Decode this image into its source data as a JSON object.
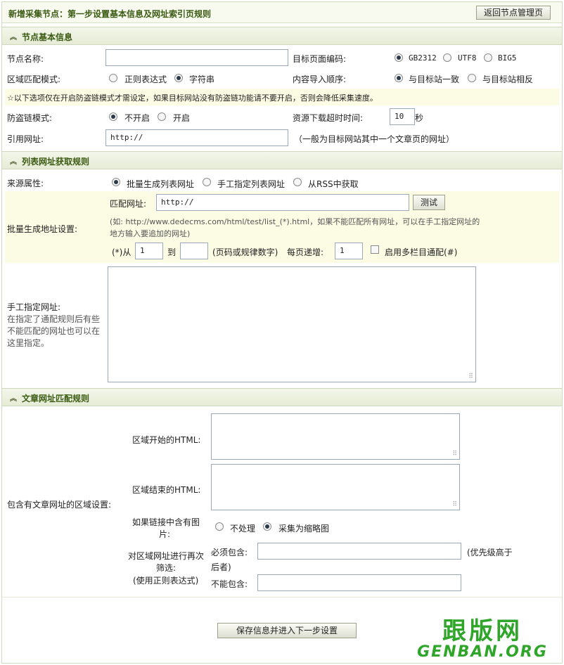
{
  "header": {
    "title": "新增采集节点：第一步设置基本信息及网址索引页规则",
    "back_button": "返回节点管理页"
  },
  "basic": {
    "section_title": "节点基本信息",
    "node_name_label": "节点名称:",
    "node_name_value": "",
    "encoding_label": "目标页面编码:",
    "encodings": [
      "GB2312",
      "UTF8",
      "BIG5"
    ],
    "encoding_selected": "GB2312",
    "match_mode_label": "区域匹配模式:",
    "match_modes": [
      "正则表达式",
      "字符串"
    ],
    "match_mode_selected": "字符串",
    "import_order_label": "内容导入顺序:",
    "import_orders": [
      "与目标站一致",
      "与目标站相反"
    ],
    "import_order_selected": "与目标站一致",
    "notice": "☆以下选项仅在开启防盗链模式才需设定，如果目标网站没有防盗链功能请不要开启，否则会降低采集速度。",
    "antileech_label": "防盗链模式:",
    "antileech_options": [
      "不开启",
      "开启"
    ],
    "antileech_selected": "不开启",
    "timeout_label": "资源下载超时时间:",
    "timeout_value": "10",
    "timeout_unit": "秒",
    "referer_label": "引用网址:",
    "referer_value": "http://",
    "referer_hint": "（一般为目标网站其中一个文章页的网址）"
  },
  "list_rules": {
    "section_title": "列表网址获取规则",
    "source_label": "来源属性:",
    "source_options": [
      "批量生成列表网址",
      "手工指定列表网址",
      "从RSS中获取"
    ],
    "source_selected": "批量生成列表网址",
    "batch_label": "批量生成地址设置:",
    "match_url_label": "匹配网址:",
    "match_url_value": "http://",
    "test_button": "测试",
    "example_line1": "(如: http://www.dedecms.com/html/test/list_(*).html，如果不能匹配所有网址，可以在手工指定网址的",
    "example_line2": "地方输入要追加的网址)",
    "from_label": "(*)从",
    "from_value": "1",
    "to_label": "到",
    "to_value": "",
    "to_hint": "(页码或规律数字)",
    "step_label": "每页递增:",
    "step_value": "1",
    "multi_label": "启用多栏目通配(#)",
    "manual_label": "手工指定网址:",
    "manual_hint_1": "在指定了通配规则后有些",
    "manual_hint_2": "不能匹配的网址也可以在",
    "manual_hint_3": "这里指定。",
    "manual_value": ""
  },
  "article_rules": {
    "section_title": "文章网址匹配规则",
    "area_label": "包含有文章网址的区域设置:",
    "start_html_label": "区域开始的HTML:",
    "end_html_label": "区域结束的HTML:",
    "image_label_1": "如果链接中含有图",
    "image_label_2": "片:",
    "image_options": [
      "不处理",
      "采集为缩略图"
    ],
    "image_selected": "采集为缩略图",
    "filter_label_1": "对区域网址进行再次",
    "filter_label_2": "筛选:",
    "filter_label_3": "(使用正则表达式)",
    "must_label": "必须包含:",
    "must_value": "",
    "priority_hint_1": "(优先级高于",
    "priority_hint_2": "后者)",
    "cannot_label": "不能包含:",
    "cannot_value": ""
  },
  "footer": {
    "submit_button": "保存信息并进入下一步设置"
  },
  "watermark": {
    "line1": "跟版网",
    "line2": "GENBAN.ORG"
  }
}
